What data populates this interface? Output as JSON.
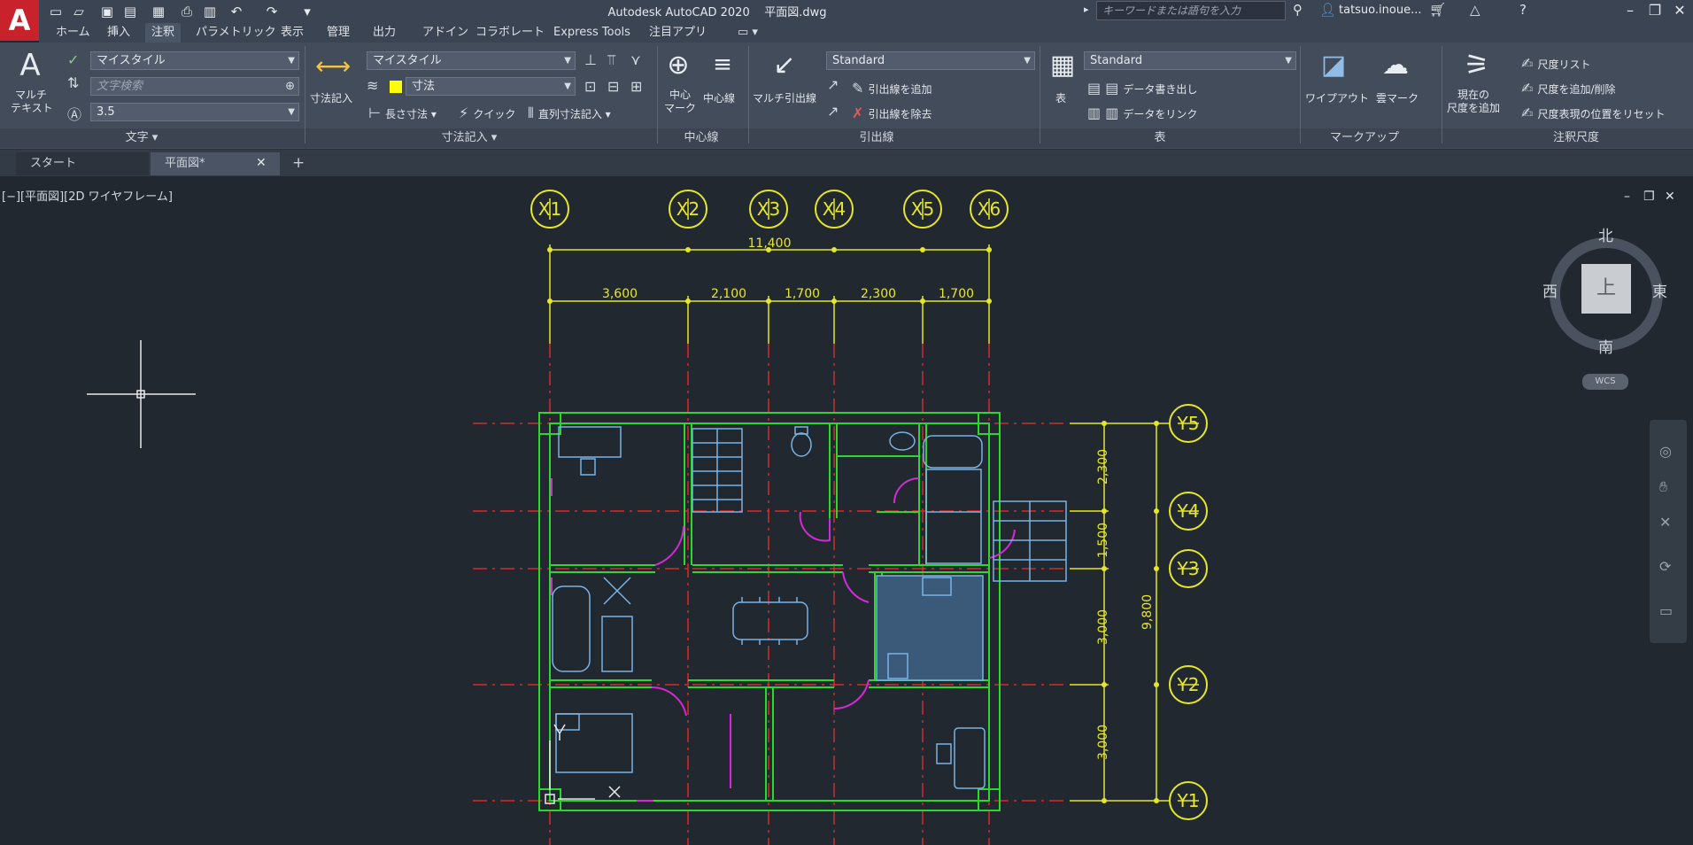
{
  "title_bar": {
    "app_title": "Autodesk AutoCAD 2020    平面図.dwg",
    "search_placeholder": "キーワードまたは語句を入力",
    "user": "tatsuo.inoue..."
  },
  "menu_tabs": [
    "ホーム",
    "挿入",
    "注釈",
    "パラメトリック",
    "表示",
    "管理",
    "出力",
    "アドイン",
    "コラボレート",
    "Express Tools",
    "注目アプリ"
  ],
  "active_menu_tab": "注釈",
  "ribbon": {
    "text_panel": {
      "title": "文字 ▾",
      "multitext_label": "マルチ\nテキスト",
      "style_combo": "マイスタイル",
      "search_placeholder": "文字検索",
      "height_combo": "3.5"
    },
    "dim_panel": {
      "title": "寸法記入 ▾",
      "dim_button": "寸法記入",
      "style_combo": "マイスタイル",
      "layer_combo": "寸法",
      "length_label": "長さ寸法",
      "quick_label": "クイック",
      "continue_label": "直列寸法記入"
    },
    "center_panel": {
      "title": "中心線",
      "center_mark": "中心\nマーク",
      "center_line": "中心線"
    },
    "leader_panel": {
      "title": "引出線",
      "multileader": "マルチ引出線",
      "style_combo": "Standard",
      "add_leader": "引出線を追加",
      "remove_leader": "引出線を除去"
    },
    "table_panel": {
      "title": "表",
      "table_button": "表",
      "style_combo": "Standard",
      "extract": "データ書き出し",
      "link": "データをリンク"
    },
    "markup_panel": {
      "title": "マークアップ",
      "wipeout": "ワイプアウト",
      "revcloud": "雲マーク"
    },
    "scale_panel": {
      "title": "注釈尺度",
      "add_current": "現在の\n尺度を追加",
      "scale_list": "尺度リスト",
      "add_delete": "尺度を追加/削除",
      "reset": "尺度表現の位置をリセット"
    }
  },
  "doc_tabs": [
    {
      "label": "スタート"
    },
    {
      "label": "平面図*"
    }
  ],
  "viewport": {
    "label": "[−][平面図][2D ワイヤフレーム]"
  },
  "viewcube": {
    "top": "上",
    "north": "北",
    "south": "南",
    "east": "東",
    "west": "西",
    "wcs": "WCS"
  },
  "drawing": {
    "x_grid_labels": [
      "X1",
      "X2",
      "X3",
      "X4",
      "X5",
      "X6"
    ],
    "y_grid_labels": [
      "Y5",
      "Y4",
      "Y3",
      "Y2",
      "Y1"
    ],
    "overall_width": "11,400",
    "x_spans": [
      "3,600",
      "2,100",
      "1,700",
      "2,300",
      "1,700"
    ],
    "overall_height": "9,800",
    "y_spans": [
      "2,300",
      "1,500",
      "3,000",
      "3,000"
    ]
  },
  "colors": {
    "grid_red": "#d42a2a",
    "dim_yellow": "#e6e62a",
    "wall_green": "#2fd62f",
    "door_magenta": "#d32ad3",
    "furniture_blue": "#7ab3e6"
  }
}
